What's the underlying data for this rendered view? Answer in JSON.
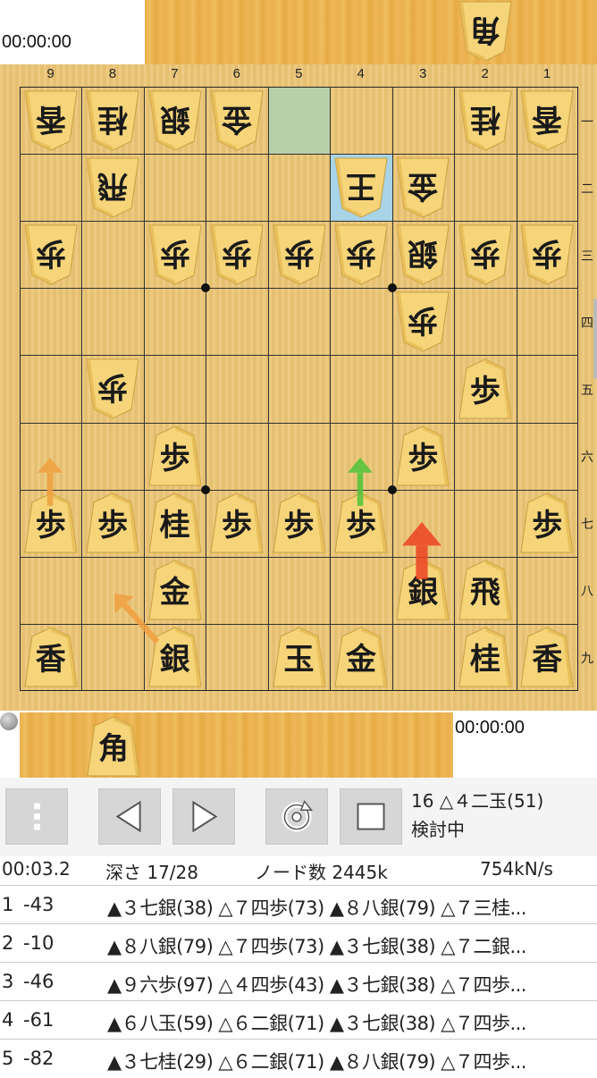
{
  "clocks": {
    "gote": "00:00:00",
    "sente": "00:00:00"
  },
  "gote_hand": [
    {
      "label": "角",
      "name": "gote-hand-bishop"
    }
  ],
  "sente_hand": [
    {
      "label": "角",
      "name": "sente-hand-bishop"
    }
  ],
  "board": {
    "file_labels": [
      "9",
      "8",
      "7",
      "6",
      "5",
      "4",
      "3",
      "2",
      "1"
    ],
    "rank_labels": [
      "一",
      "二",
      "三",
      "四",
      "五",
      "六",
      "七",
      "八",
      "九"
    ],
    "last_move_from_color": "#b8cfaa",
    "last_move_to_color": "#a9d3e6",
    "pieces": [
      {
        "file": 9,
        "rank": 1,
        "label": "香",
        "side": "gote"
      },
      {
        "file": 8,
        "rank": 1,
        "label": "桂",
        "side": "gote"
      },
      {
        "file": 7,
        "rank": 1,
        "label": "銀",
        "side": "gote"
      },
      {
        "file": 6,
        "rank": 1,
        "label": "金",
        "side": "gote"
      },
      {
        "file": 2,
        "rank": 1,
        "label": "桂",
        "side": "gote"
      },
      {
        "file": 1,
        "rank": 1,
        "label": "香",
        "side": "gote"
      },
      {
        "file": 8,
        "rank": 2,
        "label": "飛",
        "side": "gote"
      },
      {
        "file": 4,
        "rank": 2,
        "label": "王",
        "side": "gote"
      },
      {
        "file": 3,
        "rank": 2,
        "label": "金",
        "side": "gote"
      },
      {
        "file": 9,
        "rank": 3,
        "label": "歩",
        "side": "gote"
      },
      {
        "file": 7,
        "rank": 3,
        "label": "歩",
        "side": "gote"
      },
      {
        "file": 6,
        "rank": 3,
        "label": "歩",
        "side": "gote"
      },
      {
        "file": 5,
        "rank": 3,
        "label": "歩",
        "side": "gote"
      },
      {
        "file": 4,
        "rank": 3,
        "label": "歩",
        "side": "gote"
      },
      {
        "file": 3,
        "rank": 3,
        "label": "銀",
        "side": "gote"
      },
      {
        "file": 2,
        "rank": 3,
        "label": "歩",
        "side": "gote"
      },
      {
        "file": 1,
        "rank": 3,
        "label": "歩",
        "side": "gote"
      },
      {
        "file": 3,
        "rank": 4,
        "label": "歩",
        "side": "gote"
      },
      {
        "file": 8,
        "rank": 5,
        "label": "歩",
        "side": "gote"
      },
      {
        "file": 2,
        "rank": 5,
        "label": "歩",
        "side": "sente"
      },
      {
        "file": 7,
        "rank": 6,
        "label": "歩",
        "side": "sente"
      },
      {
        "file": 3,
        "rank": 6,
        "label": "歩",
        "side": "sente"
      },
      {
        "file": 9,
        "rank": 7,
        "label": "歩",
        "side": "sente"
      },
      {
        "file": 8,
        "rank": 7,
        "label": "歩",
        "side": "sente"
      },
      {
        "file": 7,
        "rank": 7,
        "label": "桂",
        "side": "sente"
      },
      {
        "file": 6,
        "rank": 7,
        "label": "歩",
        "side": "sente"
      },
      {
        "file": 5,
        "rank": 7,
        "label": "歩",
        "side": "sente"
      },
      {
        "file": 4,
        "rank": 7,
        "label": "歩",
        "side": "sente"
      },
      {
        "file": 1,
        "rank": 7,
        "label": "歩",
        "side": "sente"
      },
      {
        "file": 7,
        "rank": 8,
        "label": "金",
        "side": "sente"
      },
      {
        "file": 3,
        "rank": 8,
        "label": "銀",
        "side": "sente"
      },
      {
        "file": 2,
        "rank": 8,
        "label": "飛",
        "side": "sente"
      },
      {
        "file": 9,
        "rank": 9,
        "label": "香",
        "side": "sente"
      },
      {
        "file": 7,
        "rank": 9,
        "label": "銀",
        "side": "sente"
      },
      {
        "file": 5,
        "rank": 9,
        "label": "玉",
        "side": "sente"
      },
      {
        "file": 4,
        "rank": 9,
        "label": "金",
        "side": "sente"
      },
      {
        "file": 2,
        "rank": 9,
        "label": "桂",
        "side": "sente"
      },
      {
        "file": 1,
        "rank": 9,
        "label": "香",
        "side": "sente"
      }
    ]
  },
  "arrows": [
    {
      "name": "arrow-9-7-up",
      "color": "#f0a040"
    },
    {
      "name": "arrow-4-7-up",
      "color": "#4fc43a"
    },
    {
      "name": "arrow-3-8-up",
      "color": "#ee4422"
    },
    {
      "name": "arrow-7-9-to-8-8",
      "color": "#f0a040"
    }
  ],
  "toolbar": {
    "buttons": [
      "menu-icon",
      "prev-icon",
      "next-icon",
      "refresh-icon",
      "stop-icon"
    ],
    "move_text": "16 △４二玉(51)",
    "status_text": "検討中"
  },
  "stats": {
    "time": "00:03.2",
    "depth": "深さ  17/28",
    "nodes": "ノード数  2445k",
    "speed": "754kN/s"
  },
  "pv_lines": [
    {
      "index": "1",
      "score": "-43",
      "pv": "▲３七銀(38) △７四歩(73) ▲８八銀(79) △７三桂..."
    },
    {
      "index": "2",
      "score": "-10",
      "pv": "▲８八銀(79) △７四歩(73) ▲３七銀(38) △７二銀..."
    },
    {
      "index": "3",
      "score": "-46",
      "pv": "▲９六歩(97) △４四歩(43) ▲３七銀(38) △７四歩..."
    },
    {
      "index": "4",
      "score": "-61",
      "pv": "▲６八玉(59) △６二銀(71) ▲３七銀(38) △７四歩..."
    },
    {
      "index": "5",
      "score": "-82",
      "pv": "▲３七桂(29) △６二銀(71) ▲８八銀(79) △７四歩..."
    }
  ]
}
